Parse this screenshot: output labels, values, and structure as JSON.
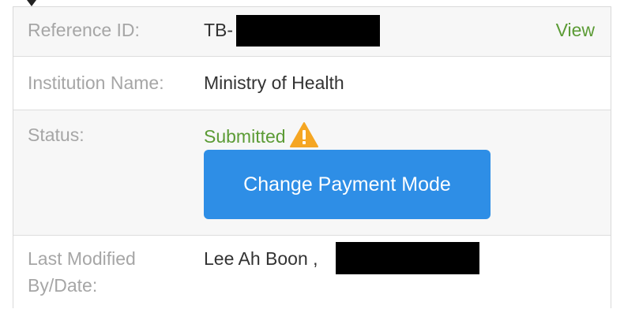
{
  "reference": {
    "label": "Reference ID:",
    "value_prefix": "TB-",
    "value_redacted": true,
    "view_link": "View"
  },
  "institution": {
    "label": "Institution Name:",
    "value": "Ministry of Health"
  },
  "status": {
    "label": "Status:",
    "value": "Submitted",
    "icon": "warning-icon",
    "button_label": "Change Payment Mode"
  },
  "last_modified": {
    "label_line1": "Last Modified",
    "label_line2": "By/Date:",
    "value_name": "Lee Ah Boon ,",
    "date_redacted": true
  },
  "colors": {
    "accent_green": "#5b9b35",
    "button_blue": "#2e8ee6",
    "label_gray": "#a6a6a6",
    "warning_orange": "#f5a623"
  }
}
